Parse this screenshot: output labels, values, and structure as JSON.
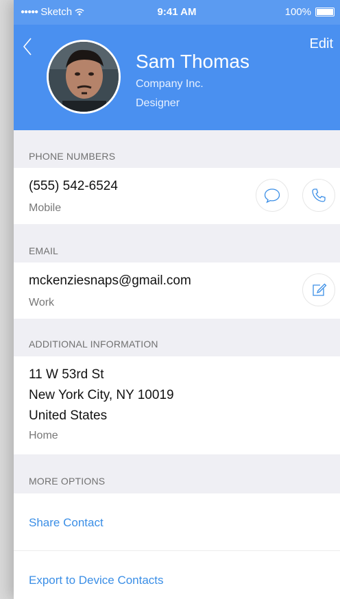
{
  "status_bar": {
    "carrier": "Sketch",
    "time": "9:41 AM",
    "battery": "100%"
  },
  "header": {
    "edit_label": "Edit",
    "name": "Sam Thomas",
    "company": "Company Inc.",
    "role": "Designer",
    "color": "#4a90f0"
  },
  "phone_section": {
    "title": "PHONE NUMBERS",
    "number": "(555) 542-6524",
    "type": "Mobile"
  },
  "email_section": {
    "title": "EMAIL",
    "email": "mckenziesnaps@gmail.com",
    "type": "Work"
  },
  "address_section": {
    "title": "ADDITIONAL INFORMATION",
    "line1": "11 W 53rd St",
    "line2": "New York City, NY 10019",
    "line3": "United States",
    "type": "Home"
  },
  "more_section": {
    "title": "MORE OPTIONS",
    "share": "Share Contact",
    "export": "Export to Device Contacts"
  },
  "icons": {
    "message": "speech-bubble-icon",
    "call": "phone-icon",
    "compose": "compose-icon",
    "back": "chevron-left-icon"
  },
  "link_color": "#3a8ee6"
}
